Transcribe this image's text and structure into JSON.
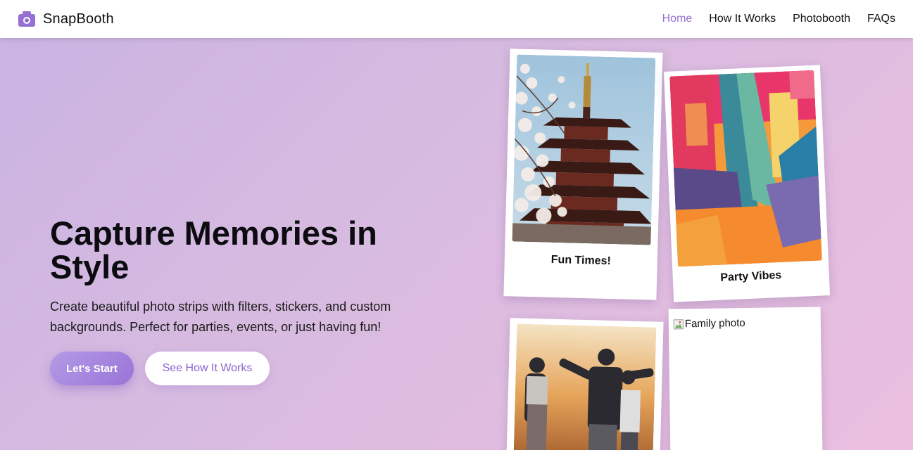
{
  "brand": {
    "name": "SnapBooth",
    "icon": "camera-icon",
    "accent": "#9470d2"
  },
  "nav": {
    "items": [
      {
        "label": "Home",
        "active": true
      },
      {
        "label": "How It Works",
        "active": false
      },
      {
        "label": "Photobooth",
        "active": false
      },
      {
        "label": "FAQs",
        "active": false
      }
    ]
  },
  "hero": {
    "title": "Capture Memories in Style",
    "description": "Create beautiful photo strips with filters, stickers, and custom backgrounds. Perfect for parties, events, or just having fun!",
    "primary_button": "Let's Start",
    "secondary_button": "See How It Works"
  },
  "gallery": {
    "cards": [
      {
        "caption": "Fun Times!",
        "image": "pagoda-cherry-blossom-photo"
      },
      {
        "caption": "Party Vibes",
        "image": "abstract-paint-photo"
      },
      {
        "caption": "",
        "image": "friends-sunset-photo"
      },
      {
        "caption": "",
        "alt": "Family photo",
        "image": "broken-image-icon"
      }
    ]
  },
  "colors": {
    "button_gradient_start": "#b39be6",
    "button_gradient_end": "#9a74d8",
    "background_start": "#c9b3e2",
    "background_end": "#ebbfe0"
  }
}
